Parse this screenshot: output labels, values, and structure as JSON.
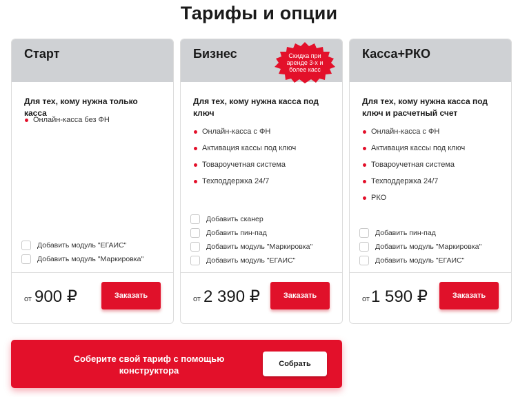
{
  "page": {
    "title": "Тарифы и опции"
  },
  "plans": [
    {
      "name": "Старт",
      "description": "Для тех, кому нужна только касса",
      "features": [
        "Онлайн-касса без ФН"
      ],
      "options": [
        "Добавить модуль \"ЕГАИС\"",
        "Добавить модуль \"Маркировка\""
      ],
      "price_prefix": "от",
      "price": "900 ₽",
      "order_label": "Заказать"
    },
    {
      "name": "Бизнес",
      "badge": "Скидка при аренде 3-х и более касс",
      "description": "Для тех, кому нужна касса под ключ",
      "features": [
        "Онлайн-касса с ФН",
        "Активация кассы под ключ",
        "Товароучетная система",
        "Техподдержка 24/7"
      ],
      "options": [
        "Добавить сканер",
        "Добавить пин-пад",
        "Добавить модуль \"Маркировка\"",
        "Добавить модуль \"ЕГАИС\""
      ],
      "price_prefix": "от",
      "price": "2 390 ₽",
      "order_label": "Заказать"
    },
    {
      "name": "Касса+РКО",
      "description": "Для тех, кому нужна касса под ключ и расчетный счет",
      "features": [
        "Онлайн-касса с ФН",
        "Активация кассы под ключ",
        "Товароучетная система",
        "Техподдержка 24/7",
        "РКО"
      ],
      "options": [
        "Добавить пин-пад",
        "Добавить модуль \"Маркировка\"",
        "Добавить модуль \"ЕГАИС\""
      ],
      "price_prefix": "от",
      "price": "1 590 ₽",
      "order_label": "Заказать"
    }
  ],
  "banner": {
    "text": "Соберите свой тариф с помощью конструктора",
    "button_label": "Собрать"
  },
  "colors": {
    "accent": "#e3102a",
    "card_header": "#cfd1d4",
    "border": "#dcdcdc"
  },
  "icons": {
    "bullet": "red-dot-icon",
    "option_toggle": "checkbox-icon",
    "badge": "starburst-badge-icon"
  }
}
